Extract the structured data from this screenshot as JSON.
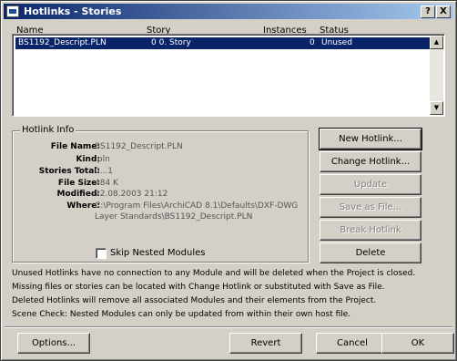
{
  "window": {
    "title": "Hotlinks - Stories"
  },
  "title_buttons": {
    "help": "?",
    "close": "X"
  },
  "columns": {
    "name": "Name",
    "story": "Story",
    "instances": "Instances",
    "status": "Status"
  },
  "list_rows": [
    {
      "name": "BS1192_Descript.PLN",
      "story": "0 0. Story",
      "instances": "0",
      "status": "Unused",
      "selected": true
    }
  ],
  "hotlink_info": {
    "group_title": "Hotlink Info",
    "labels": {
      "file_name": "File Name:",
      "kind": "Kind:",
      "stories_total": "Stories Total:",
      "file_size": "File Size:",
      "modified": "Modified:",
      "where": "Where:"
    },
    "values": {
      "file_name": "BS1192_Descript.PLN",
      "kind": ".pln",
      "stories_total": "0...1",
      "file_size": "484 K",
      "modified": "22.08.2003 21:12",
      "where_line1": "C:\\Program Files\\ArchiCAD 8.1\\Defaults\\DXF-DWG",
      "where_line2": "Layer Standards\\BS1192_Descript.PLN"
    },
    "skip_nested_label": "Skip Nested Modules",
    "skip_nested_checked": false
  },
  "side_buttons": {
    "new_hotlink": "New Hotlink...",
    "change_hotlink": "Change Hotlink...",
    "update": "Update",
    "save_as_file": "Save as File...",
    "break_hotlink": "Break Hotlink",
    "delete": "Delete"
  },
  "notes": [
    "Unused Hotlinks have no connection to any Module and will be deleted when the Project is closed.",
    "Missing files or stories can be located with Change Hotlink or substituted with Save as File.",
    "Deleted Hotlinks will remove all associated Modules and their elements from the Project.",
    "Scene Check: Nested Modules can only be updated from within their own host file."
  ],
  "footer_buttons": {
    "options": "Options...",
    "revert": "Revert",
    "cancel": "Cancel",
    "ok": "OK"
  },
  "colors": {
    "selection": "#0a246a",
    "face": "#d4d0c8",
    "title_gradient_end": "#a6caf0"
  }
}
